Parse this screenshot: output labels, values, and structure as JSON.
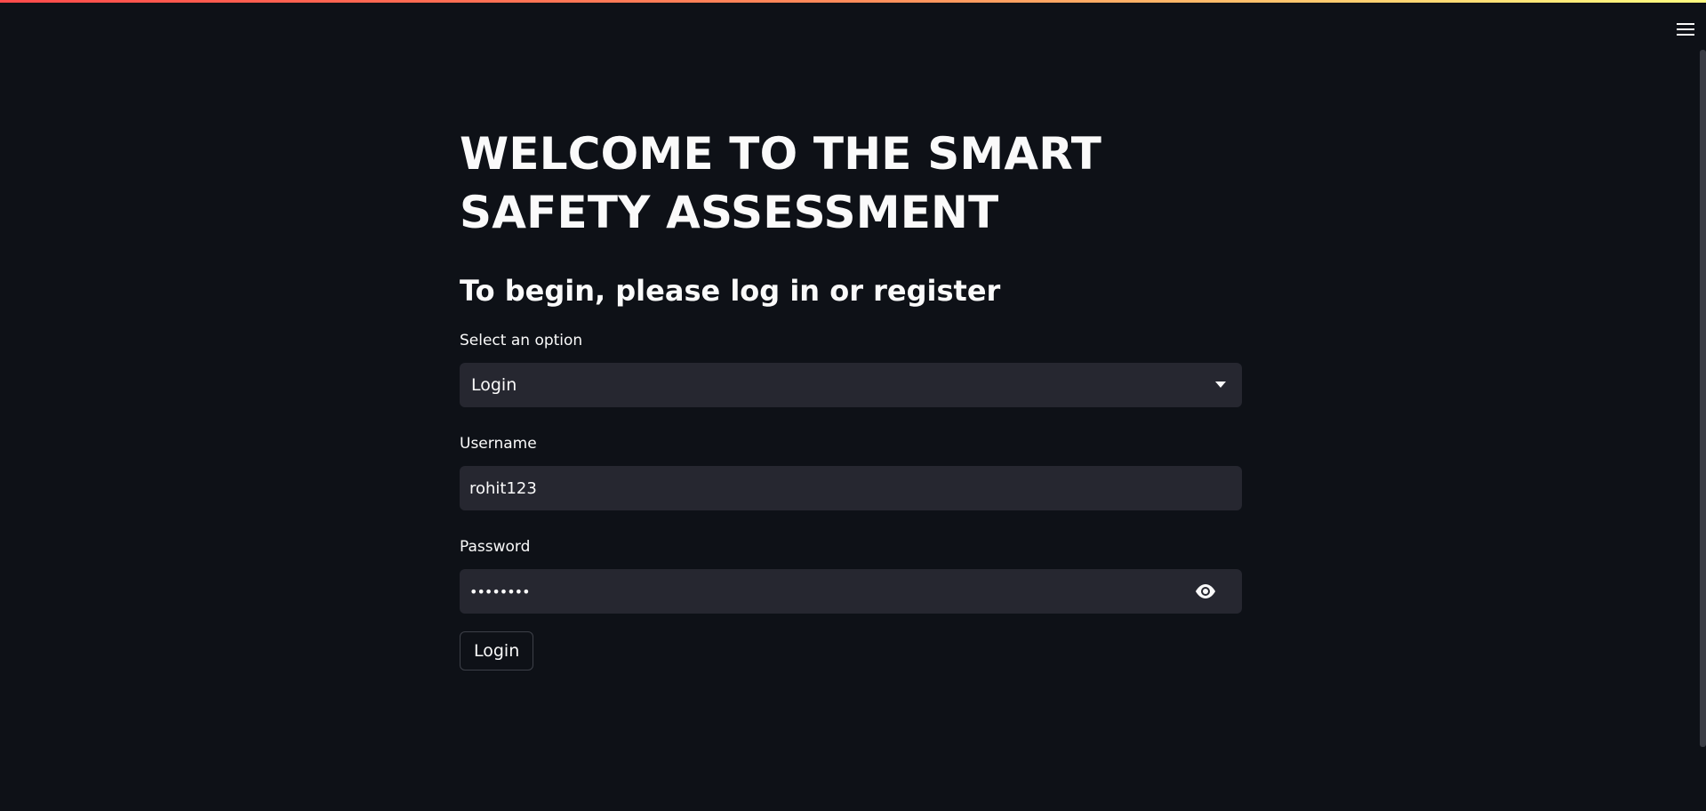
{
  "header": {
    "menu_icon": "hamburger-menu-icon"
  },
  "main": {
    "title": "WELCOME TO THE SMART SAFETY ASSESSMENT",
    "subtitle": "To begin, please log in or register",
    "select": {
      "label": "Select an option",
      "value": "Login",
      "icon": "caret-down-icon"
    },
    "username": {
      "label": "Username",
      "value": "rohit123"
    },
    "password": {
      "label": "Password",
      "masked_value": "••••••••",
      "icon": "eye-icon"
    },
    "login_button": "Login"
  },
  "colors": {
    "background": "#0e1117",
    "input_background": "#262730",
    "text": "#fafafa",
    "accent_gradient_start": "#ff4b4b",
    "accent_gradient_end": "#fffd80"
  }
}
